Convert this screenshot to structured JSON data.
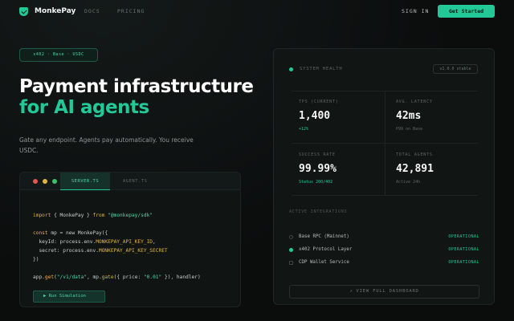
{
  "nav": {
    "brand": "MonkePay",
    "links": [
      "DOCS",
      "PRICING"
    ],
    "signin": "SIGN IN",
    "cta": "Get Started"
  },
  "hero": {
    "pill": "x402 · Base · USDC",
    "title_line1": "Payment infrastructure",
    "title_line2": "for AI agents",
    "subtitle": "Gate any endpoint. Agents pay automatically. You receive USDC."
  },
  "code_card": {
    "tabs": [
      "SERVER.TS",
      "AGENT.TS"
    ],
    "active_tab": "SERVER.TS",
    "lines": [
      "import { MonkePay } from \"@monkepay/sdk\"",
      "",
      "const mp = new MonkePay({",
      "  keyId: process.env.MONKEPAY_API_KEY_ID,",
      "  secret: process.env.MONKEPAY_API_KEY_SECRET",
      "})",
      "",
      "app.get(\"/v1/data\", mp.gate({ price: \"0.01\" }), handler)"
    ],
    "run_button": "▶ Run Simulation"
  },
  "health": {
    "title": "SYSTEM HEALTH",
    "version": "v1.0.0 stable",
    "metrics": [
      {
        "label": "TPS (CURRENT)",
        "value": "1,400",
        "sub": "+12%"
      },
      {
        "label": "AVG. LATENCY",
        "value": "42ms",
        "sub": "P99 on Base"
      },
      {
        "label": "SUCCESS RATE",
        "value": "99.99%",
        "sub": "Status 200/402"
      },
      {
        "label": "TOTAL AGENTS",
        "value": "42,891",
        "sub": "Active 24h"
      }
    ],
    "section_title": "ACTIVE INTEGRATIONS",
    "services": [
      {
        "name": "Base RPC (Mainnet)",
        "status": "OPERATIONAL",
        "icon": "ring-icon"
      },
      {
        "name": "x402 Protocol Layer",
        "status": "OPERATIONAL",
        "icon": "dot-icon"
      },
      {
        "name": "CDP Wallet Service",
        "status": "OPERATIONAL",
        "icon": "square-icon"
      }
    ],
    "view_button": "↗ VIEW FULL DASHBOARD"
  },
  "colors": {
    "accent": "#22c997",
    "background": "#0b0d0d",
    "panel": "#111615"
  }
}
